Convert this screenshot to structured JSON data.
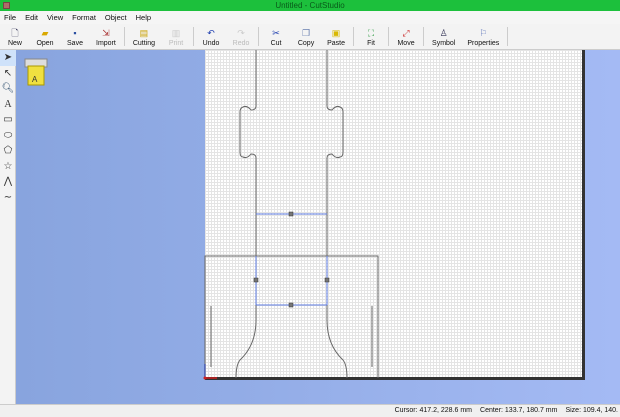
{
  "window": {
    "title": "Untitled - CutStudio"
  },
  "menu": [
    "File",
    "Edit",
    "View",
    "Format",
    "Object",
    "Help"
  ],
  "toolbar": [
    {
      "label": "New",
      "icon": "new-file-icon",
      "enabled": true
    },
    {
      "label": "Open",
      "icon": "folder-icon",
      "enabled": true
    },
    {
      "label": "Save",
      "icon": "save-icon",
      "enabled": true
    },
    {
      "label": "Import",
      "icon": "import-icon",
      "enabled": true
    },
    {
      "label": "Cutting",
      "icon": "cutter-icon",
      "enabled": true
    },
    {
      "label": "Print",
      "icon": "print-icon",
      "enabled": false
    },
    {
      "label": "Undo",
      "icon": "undo-icon",
      "enabled": true
    },
    {
      "label": "Redo",
      "icon": "redo-icon",
      "enabled": false
    },
    {
      "label": "Cut",
      "icon": "scissors-icon",
      "enabled": true
    },
    {
      "label": "Copy",
      "icon": "copy-icon",
      "enabled": true
    },
    {
      "label": "Paste",
      "icon": "paste-icon",
      "enabled": true
    },
    {
      "label": "Fit",
      "icon": "fit-icon",
      "enabled": true
    },
    {
      "label": "Move",
      "icon": "move-icon",
      "enabled": true
    },
    {
      "label": "Symbol",
      "icon": "symbol-icon",
      "enabled": true
    },
    {
      "label": "Properties",
      "icon": "properties-icon",
      "enabled": true
    }
  ],
  "status": {
    "cursor": "Cursor: 417.2, 228.6 mm",
    "center": "Center: 133.7, 180.7 mm",
    "size": "Size: 109.4, 140."
  }
}
